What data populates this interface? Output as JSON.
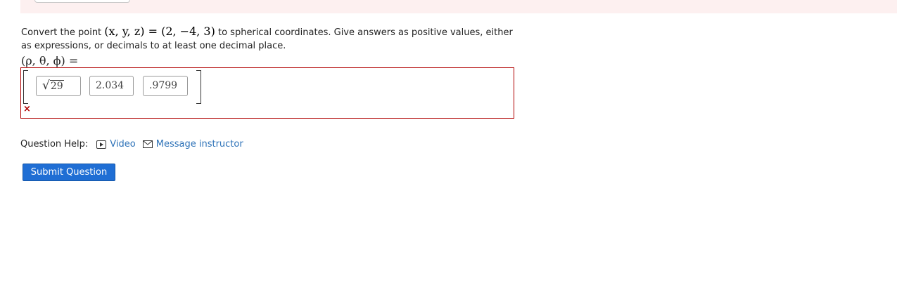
{
  "question": {
    "prefix": "Convert the point ",
    "math_lhs": "(x, y, z)",
    "math_eq": " = ",
    "math_rhs": "(2, −4, 3)",
    "suffix": " to spherical coordinates. Give answers as positive values, either as expressions, or decimals to at least one decimal place."
  },
  "answer": {
    "label": "(ρ, θ, ϕ) =",
    "entries": [
      "29",
      "2.034",
      ".9799"
    ],
    "status_icon": "x-icon",
    "status_mark": "×"
  },
  "help": {
    "label": "Question Help:",
    "video_label": "Video",
    "message_label": "Message instructor"
  },
  "actions": {
    "submit_label": "Submit Question"
  },
  "colors": {
    "error_border": "#b00000",
    "link": "#2d72b8",
    "submit_bg": "#1f6ed4",
    "banner_bg": "#fdf0f0"
  }
}
